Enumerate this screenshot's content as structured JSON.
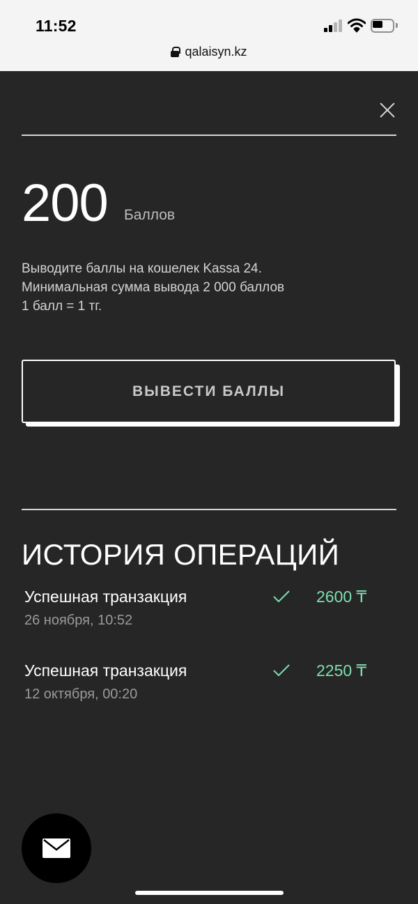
{
  "status_bar": {
    "time": "11:52",
    "url": "qalaisyn.kz",
    "icons": [
      "signal-icon",
      "wifi-icon",
      "battery-icon",
      "lock-icon"
    ]
  },
  "balance": {
    "value": "200",
    "unit": "Баллов",
    "info_lines": [
      "Выводите баллы на кошелек Kassa 24.",
      "Минимальная сумма вывода 2 000 баллов",
      "1 балл = 1 тг."
    ]
  },
  "withdraw_button": {
    "label": "ВЫВЕСТИ БАЛЛЫ"
  },
  "history": {
    "title": "ИСТОРИЯ ОПЕРАЦИЙ",
    "transactions": [
      {
        "status": "Успешная транзакция",
        "date": "26 ноября, 10:52",
        "amount": "2600 ₸"
      },
      {
        "status": "Успешная транзакция",
        "date": "12 октября, 00:20",
        "amount": "2250 ₸"
      }
    ]
  },
  "colors": {
    "background": "#262626",
    "amount_green": "#7ee0b1",
    "text_white": "#ffffff"
  }
}
